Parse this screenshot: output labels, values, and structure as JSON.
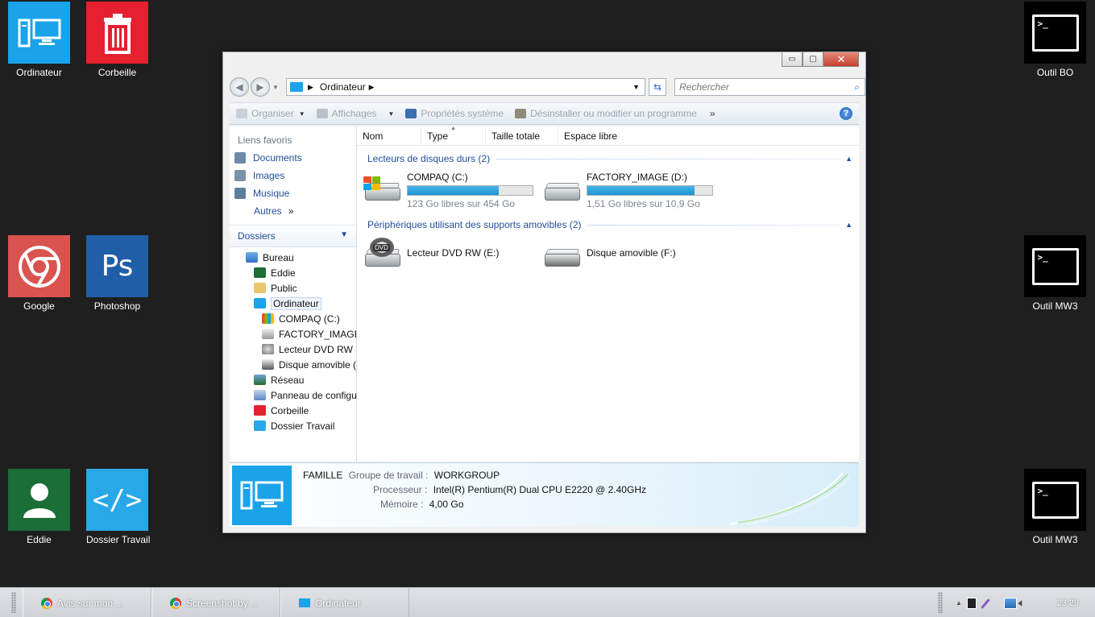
{
  "desktop": {
    "icons": [
      {
        "label": "Ordinateur",
        "icon": "computer-icon",
        "color": "#1aa3e8"
      },
      {
        "label": "Corbeille",
        "icon": "trash-icon",
        "color": "#e5202f"
      },
      {
        "label": "Google",
        "icon": "chrome-icon",
        "color": "#d9534f"
      },
      {
        "label": "Photoshop",
        "icon": "photoshop-icon",
        "color": "#1e5fa8",
        "glyph": "Ps"
      },
      {
        "label": "Eddie",
        "icon": "user-icon",
        "color": "#1a6e36"
      },
      {
        "label": "Dossier Travail",
        "icon": "code-icon",
        "color": "#29a8e8",
        "glyph": "</>"
      },
      {
        "label": "Outil BO",
        "icon": "terminal-icon"
      },
      {
        "label": "Outil MW3",
        "icon": "terminal-icon"
      },
      {
        "label": "Outil MW3",
        "icon": "terminal-icon"
      }
    ],
    "terminal_glyph": ">_"
  },
  "window": {
    "controls": {
      "minimize": "▭",
      "maximize": "▢",
      "close": "✕"
    },
    "address": {
      "location": "Ordinateur"
    },
    "search": {
      "placeholder": "Rechercher"
    },
    "toolbar": {
      "organize": "Organiser",
      "views": "Affichages",
      "system_properties": "Propriétés système",
      "uninstall": "Désinstaller ou modifier un programme",
      "more": "»",
      "help": "?"
    },
    "favorites": {
      "header": "Liens favoris",
      "items": [
        "Documents",
        "Images",
        "Musique"
      ],
      "more": "Autres",
      "more_chevron": "»"
    },
    "folders": {
      "header": "Dossiers",
      "tree": [
        {
          "label": "Bureau",
          "level": 0,
          "icon": "desktop-icon"
        },
        {
          "label": "Eddie",
          "level": 1,
          "icon": "user-icon"
        },
        {
          "label": "Public",
          "level": 1,
          "icon": "folder-icon"
        },
        {
          "label": "Ordinateur",
          "level": 1,
          "icon": "computer-icon",
          "selected": true
        },
        {
          "label": "COMPAQ (C:)",
          "level": 2,
          "icon": "windows-drive-icon"
        },
        {
          "label": "FACTORY_IMAGE",
          "level": 2,
          "icon": "drive-icon"
        },
        {
          "label": "Lecteur DVD RW (",
          "level": 2,
          "icon": "dvd-icon"
        },
        {
          "label": "Disque amovible (",
          "level": 2,
          "icon": "removable-drive-icon"
        },
        {
          "label": "Réseau",
          "level": 1,
          "icon": "network-icon"
        },
        {
          "label": "Panneau de configu",
          "level": 1,
          "icon": "control-panel-icon"
        },
        {
          "label": "Corbeille",
          "level": 1,
          "icon": "trash-icon"
        },
        {
          "label": "Dossier Travail",
          "level": 1,
          "icon": "code-icon"
        }
      ]
    },
    "columns": [
      "Nom",
      "Type",
      "Taille totale",
      "Espace libre"
    ],
    "groups": {
      "hard_drives": {
        "title": "Lecteurs de disques durs (2)",
        "items": [
          {
            "name": "COMPAQ (C:)",
            "free_text": "123 Go libres sur 454 Go",
            "used_fraction": 0.73,
            "icon": "windows-drive-icon"
          },
          {
            "name": "FACTORY_IMAGE (D:)",
            "free_text": "1,51 Go libres sur 10,9 Go",
            "used_fraction": 0.86,
            "icon": "drive-icon"
          }
        ]
      },
      "removable": {
        "title": "Périphériques utilisant des supports amovibles (2)",
        "items": [
          {
            "name": "Lecteur DVD RW (E:)",
            "icon": "dvd-icon",
            "badge": "DVD"
          },
          {
            "name": "Disque amovible (F:)",
            "icon": "removable-drive-icon"
          }
        ]
      }
    },
    "details": {
      "computer_name": "FAMILLE",
      "workgroup_label": "Groupe de travail :",
      "workgroup": "WORKGROUP",
      "processor_label": "Processeur :",
      "processor": "Intel(R) Pentium(R) Dual  CPU  E2220  @ 2.40GHz",
      "memory_label": "Mémoire :",
      "memory": "4,00 Go"
    }
  },
  "taskbar": {
    "tasks": [
      {
        "label": "Avis sur mon ...",
        "icon": "chrome-icon"
      },
      {
        "label": "Screenshot by ...",
        "icon": "chrome-icon"
      },
      {
        "label": "Ordinateur",
        "icon": "computer-icon"
      }
    ],
    "tray_arrow": "▲",
    "clock": "23:29"
  }
}
